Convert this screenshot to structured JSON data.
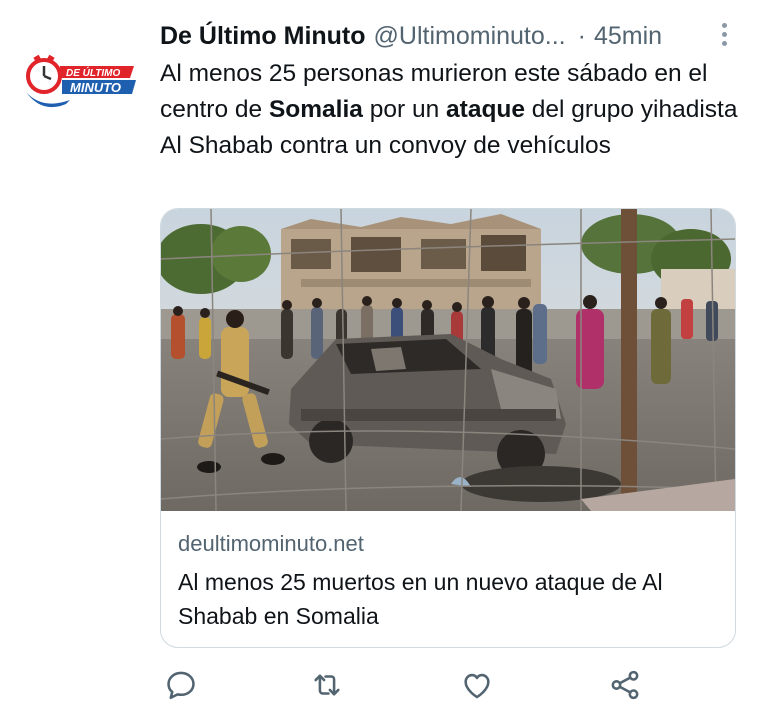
{
  "account": {
    "display_name": "De Último Minuto",
    "handle": "@Ultimominuto...",
    "separator": "·",
    "time": "45min",
    "logo_text_top": "DE ÚLTIMO",
    "logo_text_bottom": "MINUTO"
  },
  "tweet": {
    "text_parts": [
      {
        "text": "Al menos 25 personas murieron este sábado en el centro de ",
        "bold": false
      },
      {
        "text": "Somalia",
        "bold": true
      },
      {
        "text": " por un ",
        "bold": false
      },
      {
        "text": "ataque",
        "bold": true
      },
      {
        "text": " del grupo yihadista Al Shabab contra un convoy de vehículos",
        "bold": false
      }
    ]
  },
  "card": {
    "domain": "deultimominuto.net",
    "title": "Al menos 25 muertos en un nuevo ataque de Al Shabab en Somalia"
  },
  "actions": {
    "reply_icon": "reply-icon",
    "retweet_icon": "retweet-icon",
    "like_icon": "heart-icon",
    "share_icon": "share-icon"
  },
  "colors": {
    "secondary_text": "#536471",
    "border": "#cfd9de",
    "logo_red": "#e0242a",
    "logo_blue": "#1f5fb0"
  }
}
